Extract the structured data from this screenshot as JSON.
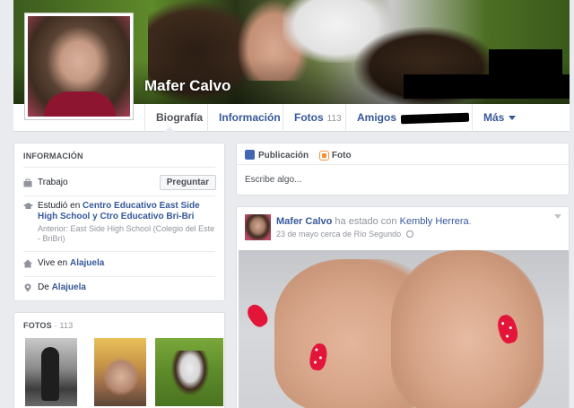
{
  "profile": {
    "name": "Mafer Calvo"
  },
  "nav": {
    "tabs": [
      {
        "label": "Biografía",
        "active": true
      },
      {
        "label": "Información"
      },
      {
        "label": "Fotos",
        "count": "113"
      },
      {
        "label": "Amigos"
      },
      {
        "label": "Más"
      }
    ]
  },
  "info": {
    "title": "INFORMACIÓN",
    "work_label": "Trabajo",
    "ask_button": "Preguntar",
    "studied_prefix": "Estudió en",
    "studied_school": "Centro Educativo East Side High School y Ctro Educativo Bri-Bri",
    "studied_previous": "Anterior: East Side High School (Colegio del Este - BriBri)",
    "lives_prefix": "Vive en",
    "lives_city": "Alajuela",
    "from_prefix": "De",
    "from_city": "Alajuela"
  },
  "photos": {
    "title": "FOTOS",
    "separator": "·",
    "count": "113"
  },
  "composer": {
    "tab_post": "Publicación",
    "tab_photo": "Foto",
    "prompt": "Escribe algo..."
  },
  "post": {
    "author": "Mafer Calvo",
    "action": "ha estado con",
    "tagged": "Kembly Herrera",
    "period": ".",
    "date": "23 de mayo",
    "near": "cerca de",
    "place": "Río Segundo"
  },
  "colors": {
    "link": "#365899",
    "nail_polish": "#e3163a",
    "page_bg": "#e9ebee"
  },
  "icons": [
    "briefcase-icon",
    "graduation-cap-icon",
    "home-icon",
    "location-pin-icon",
    "pencil-icon",
    "photo-icon",
    "globe-icon",
    "chevron-down-icon"
  ]
}
